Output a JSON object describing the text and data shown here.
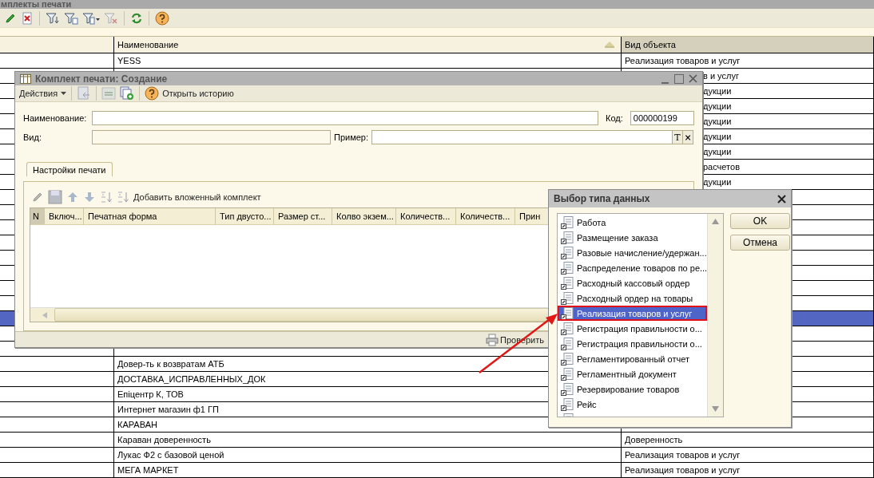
{
  "main_window": {
    "title": "мплекты печати"
  },
  "list": {
    "columns": [
      "Наименование",
      "Вид объекта"
    ],
    "rows": [
      {
        "name": "YESS",
        "object_type": "Реализация товаров и услуг",
        "selected": false
      },
      {
        "object_type": "в и услуг",
        "clipped": true,
        "selected": false
      },
      {
        "object_type": "дукции",
        "clipped": true,
        "selected": false
      },
      {
        "object_type": "дукции",
        "clipped": true,
        "selected": false
      },
      {
        "object_type": "дукции",
        "clipped": true,
        "selected": false
      },
      {
        "object_type": "дукции",
        "clipped": true,
        "selected": false
      },
      {
        "object_type": "дукции",
        "clipped": true,
        "selected": false
      },
      {
        "object_type": "расчетов",
        "clipped": true,
        "selected": false
      },
      {
        "object_type": "дукции",
        "clipped": true,
        "selected": false
      },
      {
        "selected": false
      },
      {
        "selected": false
      },
      {
        "selected": false
      },
      {
        "selected": false
      },
      {
        "selected": false
      },
      {
        "selected": false
      },
      {
        "selected": false
      },
      {
        "selected": false
      },
      {
        "selected": true
      },
      {
        "selected": false
      },
      {
        "selected": false
      },
      {
        "name": "Довер-ть к возвратам АТБ",
        "selected": false
      },
      {
        "name": "ДОСТАВКА_ИСПРАВЛЕННЫХ_ДОК",
        "selected": false
      },
      {
        "name": "Епіцентр К, ТОВ",
        "selected": false
      },
      {
        "name": "Интернет магазин ф1 ГП",
        "selected": false
      },
      {
        "name": "КАРАВАН",
        "selected": false
      },
      {
        "name": "Караван доверенность",
        "object_type": "Доверенность",
        "selected": false
      },
      {
        "name": "Лукас Ф2 с базовой ценой",
        "object_type": "Реализация товаров и услуг",
        "selected": false
      },
      {
        "name": "МЕГА МАРКЕТ",
        "object_type": "Реализация товаров и услуг",
        "selected": false
      }
    ]
  },
  "form": {
    "title": "Комплект печати: Создание",
    "actions_menu": "Действия",
    "history_button": "Открыть историю",
    "name_field": {
      "label": "Наименование:"
    },
    "code_field": {
      "label": "Код:",
      "value": "000000199"
    },
    "kind_field": {
      "label": "Вид:",
      "disabled": true
    },
    "example_field": {
      "label": "Пример:",
      "buttons": [
        "T",
        "×"
      ]
    },
    "tabs": [
      {
        "label": "Настройки печати",
        "selected": true
      }
    ],
    "add_nested_button": "Добавить вложенный комплект",
    "table_columns": [
      "N",
      "Включ...",
      "Печатная форма",
      "Тип двусто...",
      "Размер ст...",
      "Колво экзем...",
      "Количеств...",
      "Количеств...",
      "Прин"
    ],
    "check_button": "Проверить"
  },
  "type_dialog": {
    "title": "Выбор типа данных",
    "items": [
      {
        "label": "Работа",
        "selected": false,
        "annotated": false
      },
      {
        "label": "Размещение заказа",
        "selected": false,
        "annotated": false
      },
      {
        "label": "Разовые начисление/удержан...",
        "selected": false,
        "annotated": false
      },
      {
        "label": "Распределение товаров по ре...",
        "selected": false,
        "annotated": false
      },
      {
        "label": "Расходный кассовый ордер",
        "selected": false,
        "annotated": false
      },
      {
        "label": "Расходный ордер на товары",
        "selected": false,
        "annotated": false
      },
      {
        "label": "Реализация товаров и услуг",
        "selected": true,
        "annotated": true
      },
      {
        "label": "Регистрация правильности о...",
        "selected": false,
        "annotated": false
      },
      {
        "label": "Регистрация правильности о...",
        "selected": false,
        "annotated": false
      },
      {
        "label": "Регламентированный отчет",
        "selected": false,
        "annotated": false
      },
      {
        "label": "Регламентный документ",
        "selected": false,
        "annotated": false
      },
      {
        "label": "Резервирование товаров",
        "selected": false,
        "annotated": false
      },
      {
        "label": "Рейс",
        "selected": false,
        "annotated": false
      }
    ],
    "buttons": [
      "OK",
      "Отмена"
    ]
  }
}
